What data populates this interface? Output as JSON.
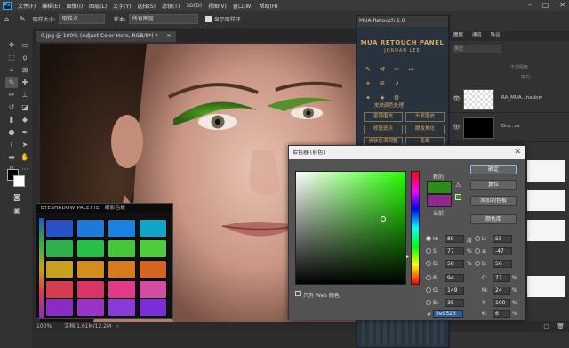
{
  "app": {
    "logo": "Ps"
  },
  "menu": [
    "文件(F)",
    "编辑(E)",
    "图像(I)",
    "图层(L)",
    "文字(Y)",
    "选择(S)",
    "滤镜(T)",
    "3D(D)",
    "视图(V)",
    "窗口(W)",
    "帮助(H)"
  ],
  "window_controls": [
    "minimize-icon",
    "maximize-icon",
    "close-icon"
  ],
  "options": {
    "tool_icon": "eyedropper-icon",
    "sample_size_label": "取样大小:",
    "sample_size_value": "取样点",
    "sample_label": "样本:",
    "sample_value": "所有图层",
    "show_ring_label": "显示取样环"
  },
  "document": {
    "tab_title": "0.jpg @ 100% (Adjust Color Here, RGB/8*) *",
    "zoom": "100%",
    "doc_info": "文档:1.61M/12.2M"
  },
  "mua_panel": {
    "title": "MUA Retouch 1.0",
    "header": "MUA RETOUCH PANEL",
    "subheader": "JORDAN LEE",
    "section_label": "皮肤颜色处理",
    "buttons": [
      "蜜铸磨皮",
      "头发磨皮",
      "修复斑点",
      "眼妆美化",
      "皮肤色调调整",
      "毛刷"
    ],
    "icons": [
      "pen-icon",
      "tool-icon",
      "brush-icon",
      "mirror-icon",
      "sun-icon",
      "grid-icon",
      "arrow-icon",
      "wand-icon",
      "star-icon",
      "settings-icon"
    ]
  },
  "right_panel": {
    "tabs": [
      "图层",
      "通道",
      "路径"
    ],
    "filter_label": "类型",
    "opacity_label": "不透明度:",
    "fill_label": "填充:",
    "layers": [
      {
        "name": "RA_MUA...hadow"
      },
      {
        "name": "Dra...re"
      }
    ]
  },
  "palette": {
    "title_en": "EYESHADOW PALETTE",
    "title_cn": "眼影色板",
    "swatches": [
      [
        "#2a52c8",
        "#1e7ad8",
        "#1a82e0",
        "#11a6c8"
      ],
      [
        "#2eb04a",
        "#26c048",
        "#45c63a",
        "#4fcc3c"
      ],
      [
        "#c8a020",
        "#d28e1c",
        "#d67a1e",
        "#d4641e"
      ],
      [
        "#d43c50",
        "#d83466",
        "#e03c86",
        "#d24ca0"
      ],
      [
        "#8a2cc4",
        "#9a34c8",
        "#8a3ad6",
        "#7a2ed8"
      ]
    ]
  },
  "color_picker": {
    "title": "拾色器 (前色)",
    "new_label": "新的",
    "current_label": "当前",
    "new_color": "#2e8c1a",
    "current_color": "#8e2a8c",
    "buttons": [
      "确定",
      "复位",
      "添加到色板",
      "颜色库"
    ],
    "web_only_label": "只有 Web 颜色",
    "fields": {
      "H": {
        "label": "H:",
        "value": "89",
        "unit": "度"
      },
      "S": {
        "label": "S:",
        "value": "77",
        "unit": "%"
      },
      "B": {
        "label": "B:",
        "value": "58",
        "unit": "%"
      },
      "R": {
        "label": "R:",
        "value": "94",
        "unit": ""
      },
      "G": {
        "label": "G:",
        "value": "149",
        "unit": ""
      },
      "Bl": {
        "label": "B:",
        "value": "35",
        "unit": ""
      },
      "L": {
        "label": "L:",
        "value": "55",
        "unit": ""
      },
      "a": {
        "label": "a:",
        "value": "-47",
        "unit": ""
      },
      "b": {
        "label": "b:",
        "value": "56",
        "unit": ""
      },
      "C": {
        "label": "C:",
        "value": "77",
        "unit": "%"
      },
      "M": {
        "label": "M:",
        "value": "24",
        "unit": "%"
      },
      "Y": {
        "label": "Y:",
        "value": "100",
        "unit": "%"
      },
      "K": {
        "label": "K:",
        "value": "6",
        "unit": "%"
      }
    },
    "hex_label": "#",
    "hex": "5e9523"
  },
  "swatches": {
    "foreground": "#000000",
    "background": "#ffffff"
  }
}
